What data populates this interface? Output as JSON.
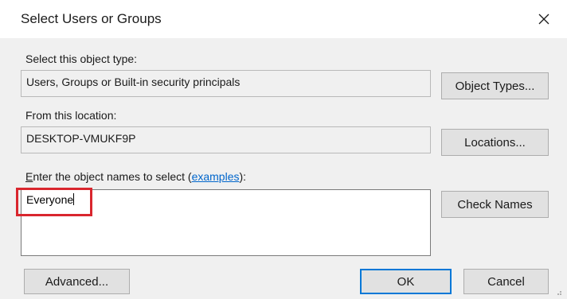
{
  "window": {
    "title": "Select Users or Groups",
    "close_icon": "close-icon"
  },
  "object_type": {
    "label": "Select this object type:",
    "value": "Users, Groups or Built-in security principals",
    "button": "Object Types..."
  },
  "location": {
    "label": "From this location:",
    "value": "DESKTOP-VMUKF9P",
    "button": "Locations..."
  },
  "names": {
    "label_first_letter": "E",
    "label_rest": "nter the object names to select (",
    "link": "examples",
    "label_end": "):",
    "value": "Everyone",
    "check_button": "Check Names"
  },
  "footer": {
    "advanced": "Advanced...",
    "ok": "OK",
    "cancel": "Cancel"
  },
  "colors": {
    "accent": "#0078d7",
    "highlight": "#d9262e",
    "link": "#0066cc"
  }
}
